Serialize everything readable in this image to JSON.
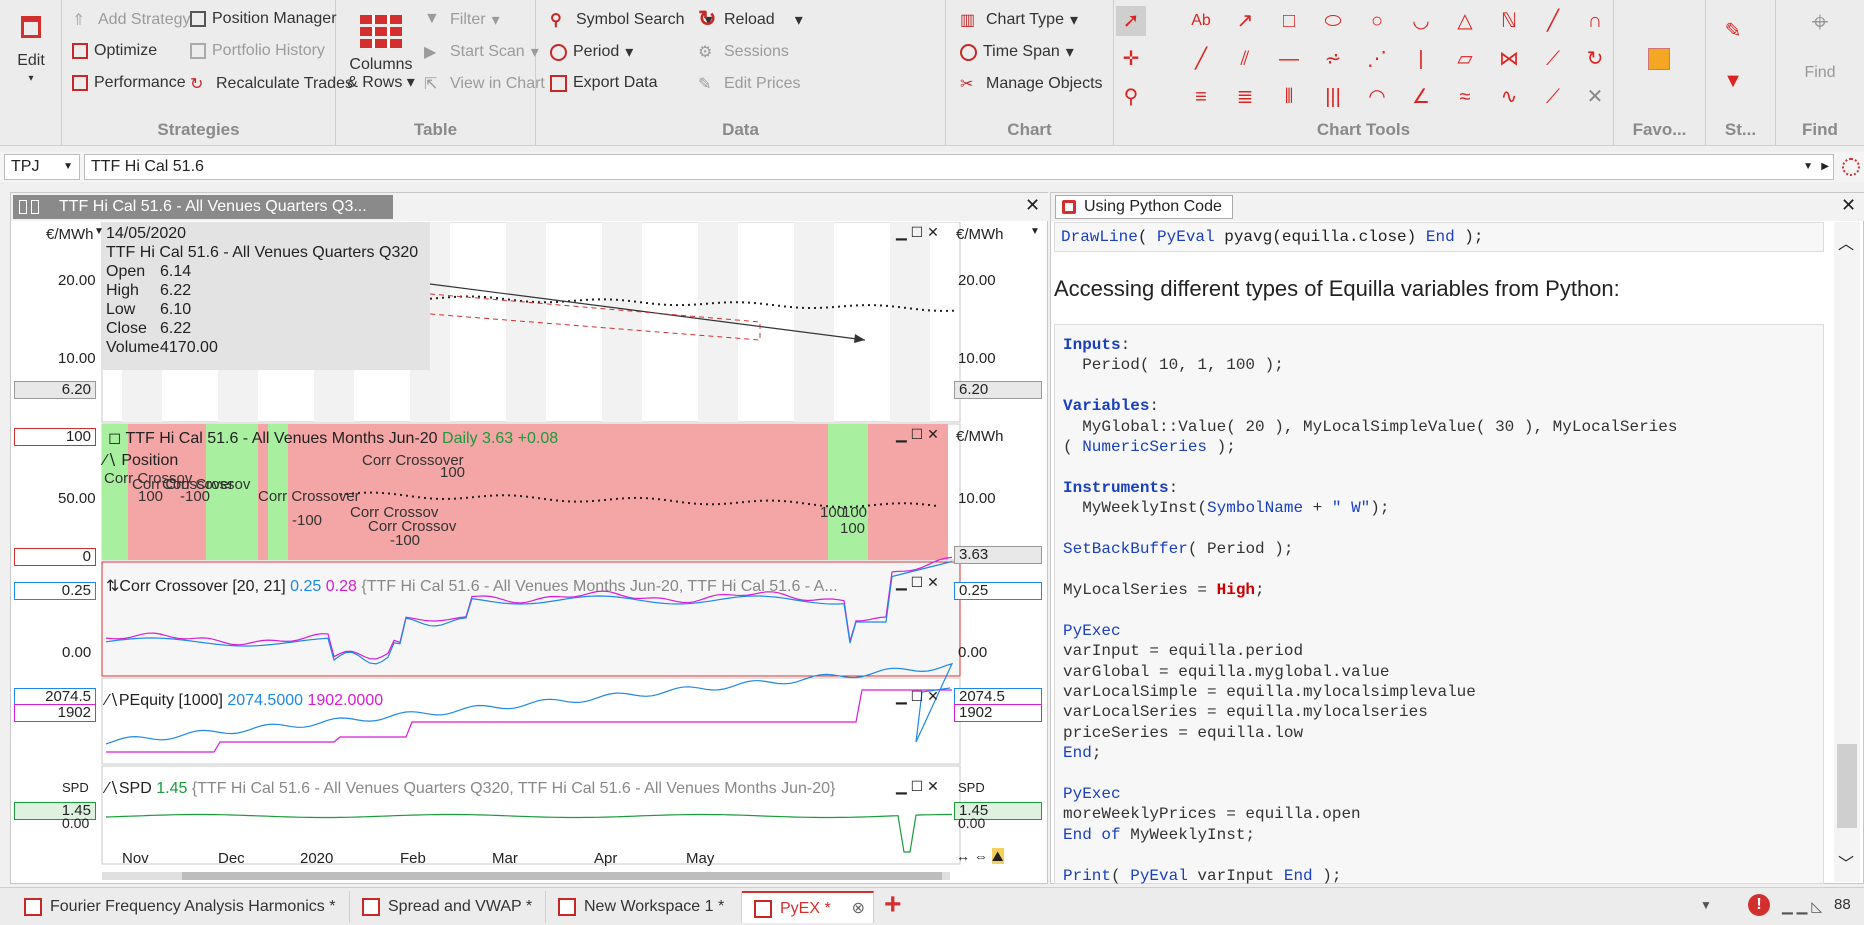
{
  "ribbon": {
    "edit": "Edit",
    "strategies": {
      "label": "Strategies",
      "add_strategy": "Add Strategy",
      "optimize": "Optimize",
      "performance": "Performance",
      "position_manager": "Position Manager",
      "portfolio_history": "Portfolio History",
      "recalculate_trades": "Recalculate Trades"
    },
    "table": {
      "label": "Table",
      "columns_rows": "Columns",
      "columns_rows2": "& Rows",
      "filter": "Filter",
      "start_scan": "Start Scan",
      "view_in_chart": "View in Chart"
    },
    "data": {
      "label": "Data",
      "symbol_search": "Symbol Search",
      "period": "Period",
      "export_data": "Export Data",
      "reload": "Reload",
      "sessions": "Sessions",
      "edit_prices": "Edit Prices"
    },
    "chart": {
      "label": "Chart",
      "chart_type": "Chart Type",
      "time_span": "Time Span",
      "manage_objects": "Manage Objects"
    },
    "chart_tools": {
      "label": "Chart Tools"
    },
    "favorites": {
      "label": "Favo..."
    },
    "styles": {
      "label": "St..."
    },
    "find": {
      "label": "Find",
      "button": "Find"
    }
  },
  "symbol_bar": {
    "exchange": "TPJ",
    "symbol": "TTF Hi Cal 51.6"
  },
  "chart_window": {
    "title": "TTF Hi Cal 51.6 - All Venues Quarters Q3...",
    "tooltip": {
      "date": "14/05/2020",
      "name": "TTF Hi Cal 51.6 - All Venues Quarters Q320",
      "rows": [
        [
          "Open",
          "6.14"
        ],
        [
          "High",
          "6.22"
        ],
        [
          "Low",
          "6.10"
        ],
        [
          "Close",
          "6.22"
        ],
        [
          "Volume",
          "4170.00"
        ]
      ]
    },
    "unit": "€/MWh",
    "pane1": {
      "ticks": [
        "20.00",
        "10.00"
      ],
      "price": "6.20"
    },
    "pane2": {
      "legend_name": "TTF Hi Cal 51.6 - All Venues Months Jun-20",
      "legend_period": "Daily",
      "legend_value": "3.63",
      "legend_change": "+0.08",
      "position_label": "Position",
      "left_ticks": [
        "100",
        "50.00",
        "0"
      ],
      "right_ticks": [
        "10.00"
      ],
      "price": "3.63",
      "annotations": [
        "Corr Crossov",
        "Corr Crossover",
        "Corr Crossov",
        "Corr Crossover",
        "Corr Crossover",
        "Corr Crossov",
        "Corr Crossov",
        "100",
        "100",
        "100",
        "100",
        "100",
        "-100",
        "-100",
        "-100"
      ]
    },
    "pane3": {
      "legend_name": "Corr Crossover",
      "params": "[20, 21]",
      "v1": "0.25",
      "v2": "0.28",
      "desc": "{TTF Hi Cal 51.6 - All Venues Months Jun-20, TTF Hi Cal 51.6 - A...",
      "ticks": [
        "0.25",
        "0.00"
      ],
      "price": "0.25"
    },
    "pane4": {
      "legend_name": "PEquity",
      "params": "[1000]",
      "v1": "2074.5000",
      "v2": "1902.0000",
      "ticks": [
        "2074.5",
        "1902"
      ],
      "price": "2074.5",
      "price2": "1902"
    },
    "pane5": {
      "legend_name": "SPD",
      "v1": "1.45",
      "desc": "{TTF Hi Cal 51.6 - All Venues Quarters Q320, TTF Hi Cal 51.6 - All Venues Months Jun-20}",
      "unit": "SPD",
      "price": "1.45",
      "tick2": "0.00"
    },
    "x_axis": [
      "Nov",
      "Dec",
      "2020",
      "Feb",
      "Mar",
      "Apr",
      "May"
    ]
  },
  "code_window": {
    "title": "Using Python Code",
    "top_line": "DrawLine( PyEval pyavg(equilla.close) End );",
    "heading": "Accessing different types of Equilla variables from Python:"
  },
  "tabs": [
    {
      "label": "Fourier Frequency Analysis Harmonics *"
    },
    {
      "label": "Spread and VWAP *"
    },
    {
      "label": "New Workspace 1 *"
    },
    {
      "label": "PyEX *"
    }
  ],
  "status": {
    "zoom": "88"
  },
  "colors": {
    "accent": "#d32f2f",
    "blue": "#1e88e5",
    "magenta": "#d81bd8",
    "green": "#1a9b3c"
  }
}
